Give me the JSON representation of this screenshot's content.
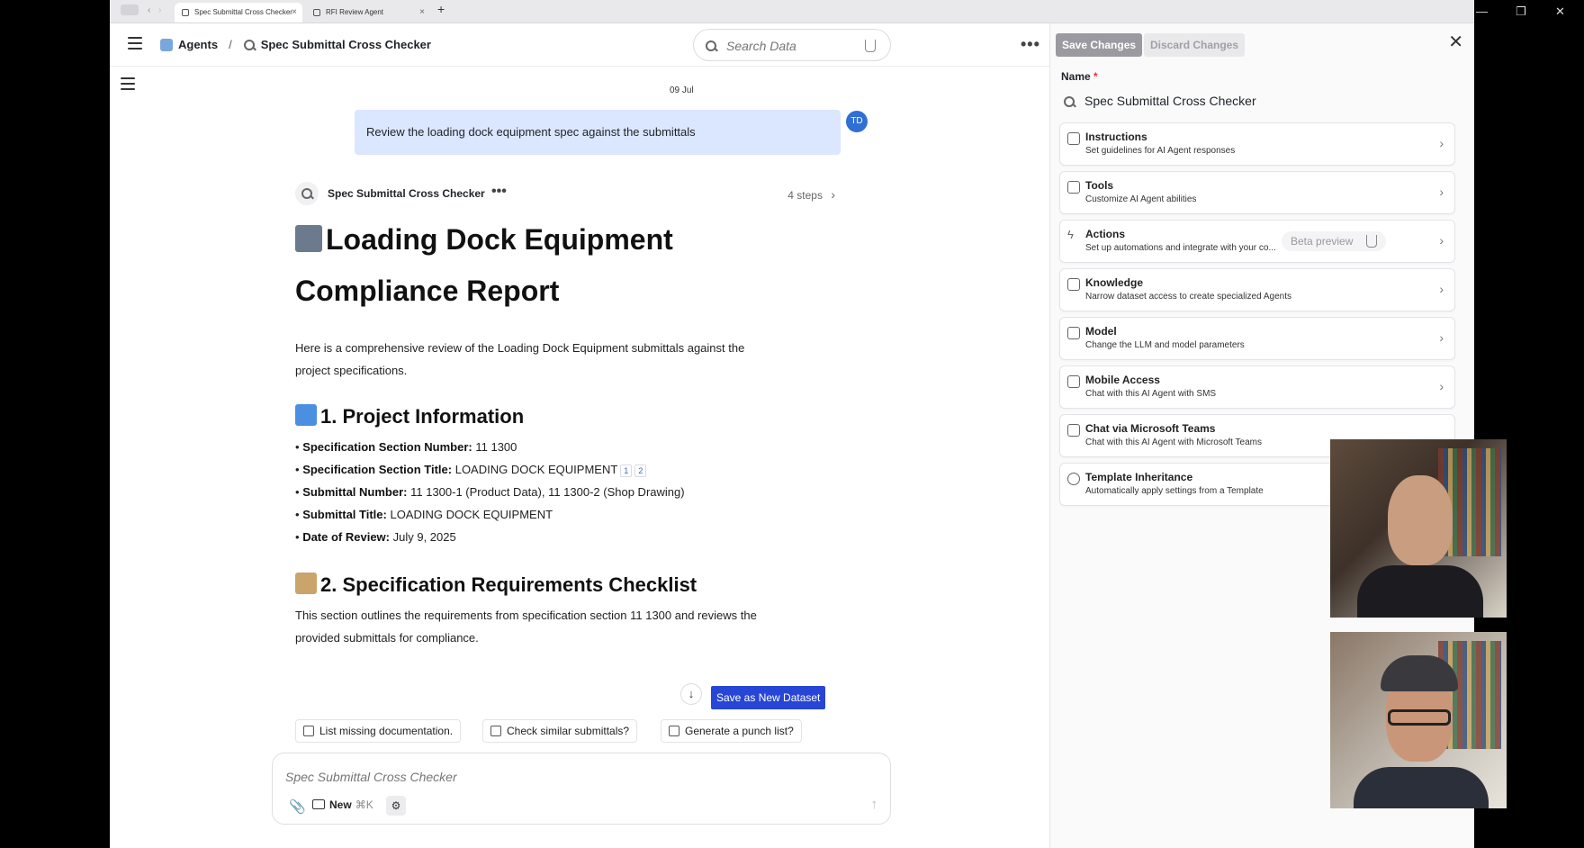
{
  "browser": {
    "tabs": [
      {
        "label": "Spec Submittal Cross Checker",
        "active": true
      },
      {
        "label": "RFI Review Agent",
        "active": false
      }
    ],
    "new_tab": "+",
    "close": "×",
    "window_minimize": "—",
    "window_restore": "❐",
    "window_close": "✕"
  },
  "header": {
    "breadcrumb_root": "Agents",
    "breadcrumb_sep": "/",
    "breadcrumb_current": "Spec Submittal Cross Checker",
    "search_placeholder": "Search Data",
    "more": "•••"
  },
  "panel": {
    "save_label": "Save Changes",
    "discard_label": "Discard Changes",
    "close": "✕",
    "name_label": "Name",
    "required_mark": "*",
    "name_value": "Spec Submittal Cross Checker",
    "chevron": "›",
    "beta_label": "Beta preview",
    "items": [
      {
        "title": "Instructions",
        "subtitle": "Set guidelines for AI Agent responses",
        "icon": "graduation-cap-icon"
      },
      {
        "title": "Tools",
        "subtitle": "Customize AI Agent abilities",
        "icon": "tools-icon"
      },
      {
        "title": "Actions",
        "subtitle": "Set up automations and integrate with your co...",
        "icon": "bolt-icon"
      },
      {
        "title": "Knowledge",
        "subtitle": "Narrow dataset access to create specialized Agents",
        "icon": "table-icon"
      },
      {
        "title": "Model",
        "subtitle": "Change the LLM and model parameters",
        "icon": "sliders-icon"
      },
      {
        "title": "Mobile Access",
        "subtitle": "Chat with this AI Agent with SMS",
        "icon": "phone-icon"
      },
      {
        "title": "Chat via Microsoft Teams",
        "subtitle": "Chat with this AI Agent with Microsoft Teams",
        "icon": "teams-icon"
      },
      {
        "title": "Template Inheritance",
        "subtitle": "Automatically apply settings from a Template",
        "icon": "template-icon"
      }
    ]
  },
  "chat": {
    "date": "09 Jul",
    "user_message": "Review the loading dock equipment spec against the submittals",
    "user_initials": "TD",
    "agent_name": "Spec Submittal Cross Checker",
    "agent_more": "•••",
    "steps": "4 steps",
    "steps_chevron": "›",
    "report_title_line1": "Loading Dock Equipment",
    "report_title_line2": "Compliance Report",
    "intro_line1": "Here is a comprehensive review of the Loading Dock Equipment submittals against the",
    "intro_line2": "project specifications.",
    "section1_title": "1. Project Information",
    "section1_items": [
      {
        "label": "Specification Section Number:",
        "value": "11 1300"
      },
      {
        "label": "Specification Section Title:",
        "value": "LOADING DOCK EQUIPMENT"
      },
      {
        "label": "Submittal Number:",
        "value": "11 1300-1 (Product Data), 11 1300-2 (Shop Drawing)"
      },
      {
        "label": "Submittal Title:",
        "value": "LOADING DOCK EQUIPMENT"
      },
      {
        "label": "Date of Review:",
        "value": "July 9, 2025"
      }
    ],
    "citations": [
      "1",
      "2"
    ],
    "bullet": "•",
    "section2_title": "2. Specification Requirements Checklist",
    "section2_line1": "This section outlines the requirements from specification section 11 1300 and reviews the",
    "section2_line2": "provided submittals for compliance.",
    "scroll_down": "↓",
    "save_dataset": "Save as New Dataset",
    "suggestions": [
      "List missing documentation.",
      "Check similar submittals?",
      "Generate a punch list?"
    ],
    "composer_placeholder": "Spec Submittal Cross Checker",
    "new_label": "New",
    "new_shortcut": "⌘K",
    "attach": "📎",
    "send": "↑",
    "brain": "⚙"
  },
  "colors": {
    "accent": "#2746d6",
    "user_bubble": "#dbe6ff",
    "avatar": "#2f6fd6"
  }
}
